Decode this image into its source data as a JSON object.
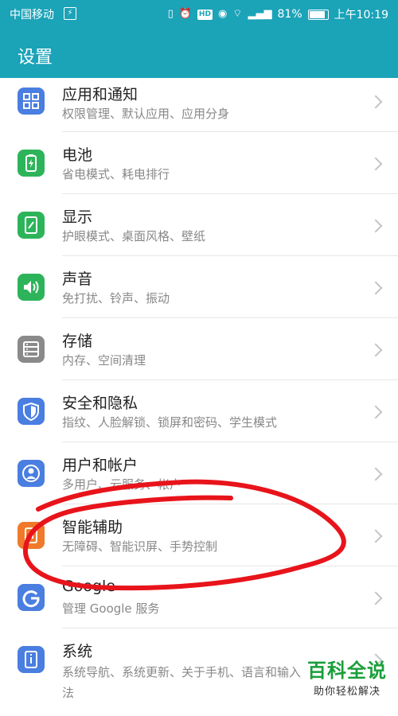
{
  "status_bar": {
    "carrier": "中国移动",
    "battery_percent": "81%",
    "time": "上午10:19"
  },
  "header": {
    "title": "设置"
  },
  "settings": [
    {
      "title": "应用和通知",
      "subtitle": "权限管理、默认应用、应用分身",
      "icon": "apps-grid-icon",
      "color": "#4a7ee0"
    },
    {
      "title": "电池",
      "subtitle": "省电模式、耗电排行",
      "icon": "battery-icon",
      "color": "#2db45a"
    },
    {
      "title": "显示",
      "subtitle": "护眼模式、桌面风格、壁纸",
      "icon": "display-icon",
      "color": "#2db45a"
    },
    {
      "title": "声音",
      "subtitle": "免打扰、铃声、振动",
      "icon": "speaker-icon",
      "color": "#2db45a"
    },
    {
      "title": "存储",
      "subtitle": "内存、空间清理",
      "icon": "storage-icon",
      "color": "#8a8a8a"
    },
    {
      "title": "安全和隐私",
      "subtitle": "指纹、人脸解锁、锁屏和密码、学生模式",
      "icon": "shield-icon",
      "color": "#4a7ee0"
    },
    {
      "title": "用户和帐户",
      "subtitle": "多用户、云服务、帐户",
      "icon": "user-icon",
      "color": "#4a7ee0"
    },
    {
      "title": "智能辅助",
      "subtitle": "无障碍、智能识屏、手势控制",
      "icon": "hand-icon",
      "color": "#f07a2a"
    },
    {
      "title": "Google",
      "subtitle": "管理 Google 服务",
      "icon": "google-icon",
      "color": "#4a7ee0"
    },
    {
      "title": "系统",
      "subtitle": "系统导航、系统更新、关于手机、语言和输入法",
      "icon": "system-info-icon",
      "color": "#4a7ee0"
    }
  ],
  "watermark": {
    "main": "百科全说",
    "sub": "助你轻松解决"
  },
  "annotation": {
    "color": "#e8141b"
  }
}
